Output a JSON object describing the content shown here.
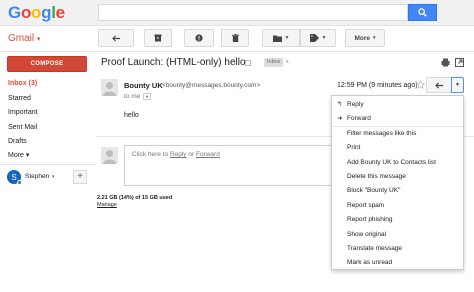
{
  "logo": {
    "text": "Google",
    "colors": [
      "#4285f4",
      "#ea4335",
      "#fbbc05",
      "#4285f4",
      "#34a853",
      "#ea4335"
    ]
  },
  "app_label": {
    "text": "Gmail",
    "caret": "▾"
  },
  "toolbar": {
    "more_label": "More",
    "more_caret": "▾"
  },
  "sidebar": {
    "compose_label": "COMPOSE",
    "items": [
      {
        "label": "Inbox (3)",
        "active": true
      },
      {
        "label": "Starred"
      },
      {
        "label": "Important"
      },
      {
        "label": "Sent Mail"
      },
      {
        "label": "Drafts"
      },
      {
        "label": "More ▾"
      }
    ],
    "user_initial": "S",
    "user_name": "Stephen",
    "user_caret": "▾",
    "add_symbol": "+"
  },
  "thread": {
    "subject": "Proof Launch: (HTML-only) hello",
    "label": "Inbox",
    "label_close": "x"
  },
  "message": {
    "sender_name": "Bounty UK",
    "sender_email": "<bounty@messages.bounty.com>",
    "to": "to me",
    "time": "12:59 PM (9 minutes ago)",
    "body": "hello"
  },
  "reply_box": {
    "prefix": "Click here to ",
    "reply": "Reply",
    "or": " or ",
    "forward": "Forward"
  },
  "storage": {
    "usage": "2.21 GB (14%) of 15 GB used",
    "manage": "Manage"
  },
  "menu": {
    "items": [
      {
        "label": "Reply",
        "icon": "reply-icon",
        "glyph": "↰"
      },
      {
        "label": "Forward",
        "icon": "forward-icon",
        "glyph": "➜"
      },
      {
        "label": "Filter messages like this"
      },
      {
        "label": "Print"
      },
      {
        "label": "Add Bounty UK to Contacts list"
      },
      {
        "label": "Delete this message"
      },
      {
        "label": "Block \"Bounty UK\""
      },
      {
        "label": "Report spam"
      },
      {
        "label": "Report phishing"
      },
      {
        "label": "Show original"
      },
      {
        "label": "Translate message"
      },
      {
        "label": "Mark as unread"
      }
    ]
  },
  "colors": {
    "accent_red": "#dd4b39",
    "search_blue": "#4285f4",
    "compose_red": "#d14836"
  }
}
